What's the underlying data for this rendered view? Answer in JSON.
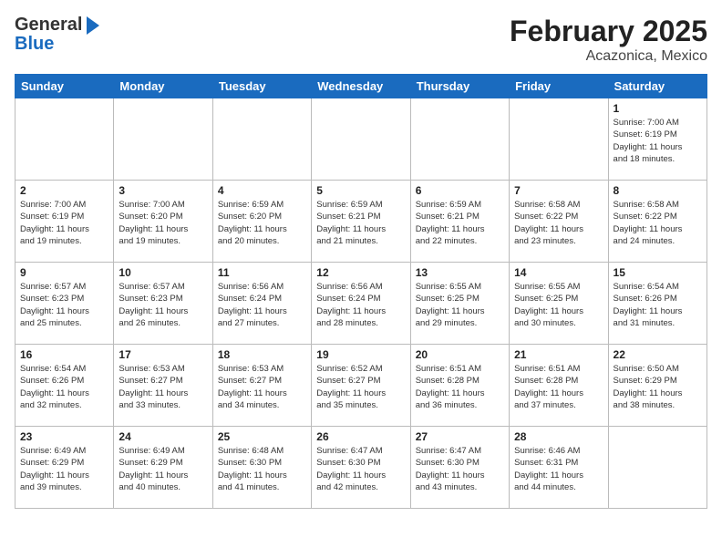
{
  "header": {
    "logo_line1": "General",
    "logo_line2": "Blue",
    "month": "February 2025",
    "location": "Acazonica, Mexico"
  },
  "weekdays": [
    "Sunday",
    "Monday",
    "Tuesday",
    "Wednesday",
    "Thursday",
    "Friday",
    "Saturday"
  ],
  "weeks": [
    [
      {
        "day": "",
        "info": ""
      },
      {
        "day": "",
        "info": ""
      },
      {
        "day": "",
        "info": ""
      },
      {
        "day": "",
        "info": ""
      },
      {
        "day": "",
        "info": ""
      },
      {
        "day": "",
        "info": ""
      },
      {
        "day": "1",
        "info": "Sunrise: 7:00 AM\nSunset: 6:19 PM\nDaylight: 11 hours\nand 18 minutes."
      }
    ],
    [
      {
        "day": "2",
        "info": "Sunrise: 7:00 AM\nSunset: 6:19 PM\nDaylight: 11 hours\nand 19 minutes."
      },
      {
        "day": "3",
        "info": "Sunrise: 7:00 AM\nSunset: 6:20 PM\nDaylight: 11 hours\nand 19 minutes."
      },
      {
        "day": "4",
        "info": "Sunrise: 6:59 AM\nSunset: 6:20 PM\nDaylight: 11 hours\nand 20 minutes."
      },
      {
        "day": "5",
        "info": "Sunrise: 6:59 AM\nSunset: 6:21 PM\nDaylight: 11 hours\nand 21 minutes."
      },
      {
        "day": "6",
        "info": "Sunrise: 6:59 AM\nSunset: 6:21 PM\nDaylight: 11 hours\nand 22 minutes."
      },
      {
        "day": "7",
        "info": "Sunrise: 6:58 AM\nSunset: 6:22 PM\nDaylight: 11 hours\nand 23 minutes."
      },
      {
        "day": "8",
        "info": "Sunrise: 6:58 AM\nSunset: 6:22 PM\nDaylight: 11 hours\nand 24 minutes."
      }
    ],
    [
      {
        "day": "9",
        "info": "Sunrise: 6:57 AM\nSunset: 6:23 PM\nDaylight: 11 hours\nand 25 minutes."
      },
      {
        "day": "10",
        "info": "Sunrise: 6:57 AM\nSunset: 6:23 PM\nDaylight: 11 hours\nand 26 minutes."
      },
      {
        "day": "11",
        "info": "Sunrise: 6:56 AM\nSunset: 6:24 PM\nDaylight: 11 hours\nand 27 minutes."
      },
      {
        "day": "12",
        "info": "Sunrise: 6:56 AM\nSunset: 6:24 PM\nDaylight: 11 hours\nand 28 minutes."
      },
      {
        "day": "13",
        "info": "Sunrise: 6:55 AM\nSunset: 6:25 PM\nDaylight: 11 hours\nand 29 minutes."
      },
      {
        "day": "14",
        "info": "Sunrise: 6:55 AM\nSunset: 6:25 PM\nDaylight: 11 hours\nand 30 minutes."
      },
      {
        "day": "15",
        "info": "Sunrise: 6:54 AM\nSunset: 6:26 PM\nDaylight: 11 hours\nand 31 minutes."
      }
    ],
    [
      {
        "day": "16",
        "info": "Sunrise: 6:54 AM\nSunset: 6:26 PM\nDaylight: 11 hours\nand 32 minutes."
      },
      {
        "day": "17",
        "info": "Sunrise: 6:53 AM\nSunset: 6:27 PM\nDaylight: 11 hours\nand 33 minutes."
      },
      {
        "day": "18",
        "info": "Sunrise: 6:53 AM\nSunset: 6:27 PM\nDaylight: 11 hours\nand 34 minutes."
      },
      {
        "day": "19",
        "info": "Sunrise: 6:52 AM\nSunset: 6:27 PM\nDaylight: 11 hours\nand 35 minutes."
      },
      {
        "day": "20",
        "info": "Sunrise: 6:51 AM\nSunset: 6:28 PM\nDaylight: 11 hours\nand 36 minutes."
      },
      {
        "day": "21",
        "info": "Sunrise: 6:51 AM\nSunset: 6:28 PM\nDaylight: 11 hours\nand 37 minutes."
      },
      {
        "day": "22",
        "info": "Sunrise: 6:50 AM\nSunset: 6:29 PM\nDaylight: 11 hours\nand 38 minutes."
      }
    ],
    [
      {
        "day": "23",
        "info": "Sunrise: 6:49 AM\nSunset: 6:29 PM\nDaylight: 11 hours\nand 39 minutes."
      },
      {
        "day": "24",
        "info": "Sunrise: 6:49 AM\nSunset: 6:29 PM\nDaylight: 11 hours\nand 40 minutes."
      },
      {
        "day": "25",
        "info": "Sunrise: 6:48 AM\nSunset: 6:30 PM\nDaylight: 11 hours\nand 41 minutes."
      },
      {
        "day": "26",
        "info": "Sunrise: 6:47 AM\nSunset: 6:30 PM\nDaylight: 11 hours\nand 42 minutes."
      },
      {
        "day": "27",
        "info": "Sunrise: 6:47 AM\nSunset: 6:30 PM\nDaylight: 11 hours\nand 43 minutes."
      },
      {
        "day": "28",
        "info": "Sunrise: 6:46 AM\nSunset: 6:31 PM\nDaylight: 11 hours\nand 44 minutes."
      },
      {
        "day": "",
        "info": ""
      }
    ]
  ]
}
